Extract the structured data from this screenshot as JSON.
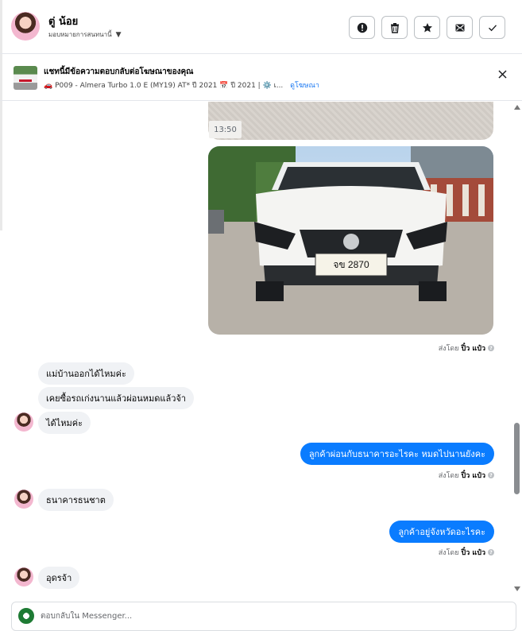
{
  "header": {
    "contact_name": "ตู่ น้อย",
    "assign_label": "มอบหมายการสนทนานี้",
    "actions": [
      "report-icon",
      "trash-icon",
      "star-icon",
      "mark-unread-icon",
      "check-icon"
    ]
  },
  "ad_banner": {
    "title": "แชทนี้มีข้อความตอบกลับต่อโฆษณาของคุณ",
    "details": "🚗 P009 - Almera Turbo 1.0 E (MY19) AT* ปี 2021 📅 ปี 2021 | ⚙️ เ...",
    "link": "ดูโฆษณา"
  },
  "messages": {
    "image_time": "13:50",
    "plate_text": "จข 2870",
    "sent_prefix": "ส่งโดย",
    "sent_name": "ปิ๋ว แป๋ว",
    "in_1": "แม่บ้านออกได้ไหมค่ะ",
    "in_2": "เคยซื้อรถเก่งนานแล้วผ่อนหมดแล้วจ้า",
    "in_3": "ได้ไหมค่ะ",
    "out_1": "ลูกค้าผ่อนกับธนาคารอะไรคะ  หมดไปนานยังคะ",
    "in_4": "ธนาคารธนชาต",
    "out_2": "ลูกค้าอยู่จังหวัดอะไรคะ",
    "in_5": "อุดรจ้า"
  },
  "composer": {
    "placeholder": "ตอบกลับใน Messenger..."
  },
  "colors": {
    "outgoing_bubble": "#0a7cff",
    "incoming_bubble": "#f0f2f5",
    "link": "#1877f2"
  }
}
